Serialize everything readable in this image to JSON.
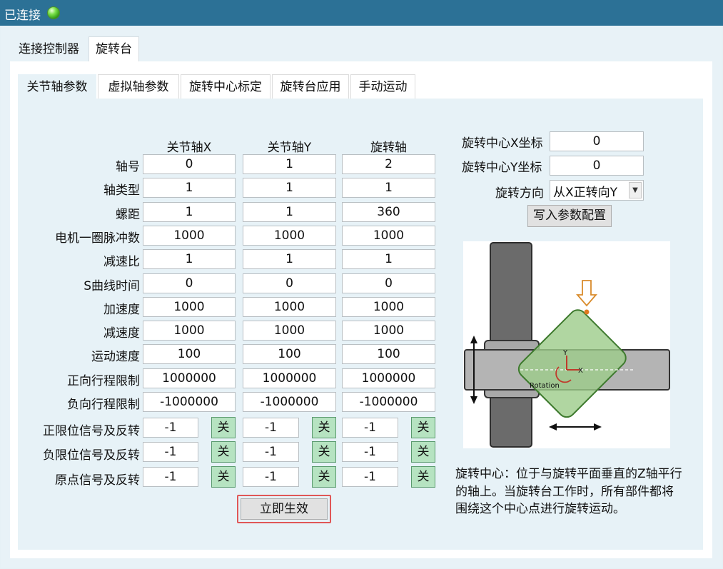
{
  "window": {
    "status": "已连接",
    "status_color": "#3cc31e"
  },
  "outer_tabs": [
    "连接控制器",
    "旋转台"
  ],
  "inner_tabs": [
    "关节轴参数",
    "虚拟轴参数",
    "旋转中心标定",
    "旋转台应用",
    "手动运动"
  ],
  "columns": [
    "关节轴X",
    "关节轴Y",
    "旋转轴"
  ],
  "params": [
    {
      "label": "轴号",
      "values": [
        "0",
        "1",
        "2"
      ]
    },
    {
      "label": "轴类型",
      "values": [
        "1",
        "1",
        "1"
      ]
    },
    {
      "label": "螺距",
      "values": [
        "1",
        "1",
        "360"
      ]
    },
    {
      "label": "电机一圈脉冲数",
      "values": [
        "1000",
        "1000",
        "1000"
      ]
    },
    {
      "label": "减速比",
      "values": [
        "1",
        "1",
        "1"
      ]
    },
    {
      "label": "S曲线时间",
      "values": [
        "0",
        "0",
        "0"
      ]
    },
    {
      "label": "加速度",
      "values": [
        "1000",
        "1000",
        "1000"
      ]
    },
    {
      "label": "减速度",
      "values": [
        "1000",
        "1000",
        "1000"
      ]
    },
    {
      "label": "运动速度",
      "values": [
        "100",
        "100",
        "100"
      ]
    },
    {
      "label": "正向行程限制",
      "values": [
        "1000000",
        "1000000",
        "1000000"
      ]
    },
    {
      "label": "负向行程限制",
      "values": [
        "-1000000",
        "-1000000",
        "-1000000"
      ]
    }
  ],
  "signals": [
    {
      "label": "正限位信号及反转",
      "values": [
        "-1",
        "-1",
        "-1"
      ],
      "toggles": [
        "关",
        "关",
        "关"
      ]
    },
    {
      "label": "负限位信号及反转",
      "values": [
        "-1",
        "-1",
        "-1"
      ],
      "toggles": [
        "关",
        "关",
        "关"
      ]
    },
    {
      "label": "原点信号及反转",
      "values": [
        "-1",
        "-1",
        "-1"
      ],
      "toggles": [
        "关",
        "关",
        "关"
      ]
    }
  ],
  "apply_label": "立即生效",
  "right": {
    "center_x_label": "旋转中心X坐标",
    "center_x_value": "0",
    "center_y_label": "旋转中心Y坐标",
    "center_y_value": "0",
    "direction_label": "旋转方向",
    "direction_value": "从X正转向Y",
    "write_label": "写入参数配置",
    "diagram": {
      "rotation_label": "Rotation",
      "x_axis": "X",
      "y_axis": "Y"
    },
    "description": "旋转中心：位于与旋转平面垂直的Z轴平行的轴上。当旋转台工作时，所有部件都将围绕这个中心点进行旋转运动。"
  }
}
